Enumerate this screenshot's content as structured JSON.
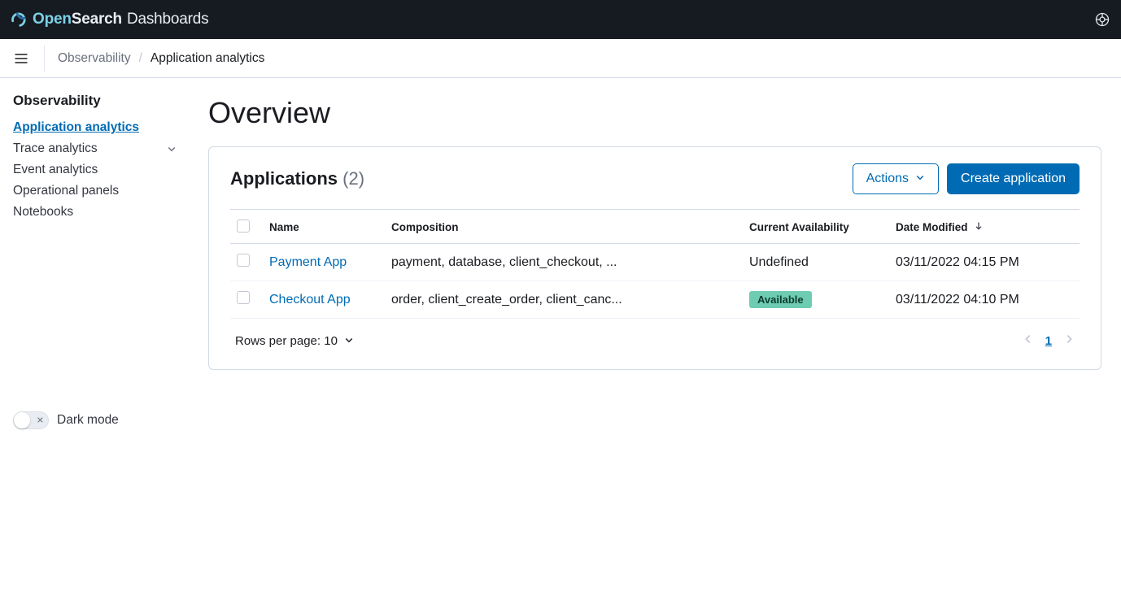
{
  "brand": {
    "open": "Open",
    "search": "Search",
    "dash": "Dashboards"
  },
  "breadcrumb": {
    "root": "Observability",
    "current": "Application analytics"
  },
  "sidebar": {
    "title": "Observability",
    "items": [
      {
        "label": "Application analytics",
        "active": true
      },
      {
        "label": "Trace analytics",
        "expandable": true
      },
      {
        "label": "Event analytics"
      },
      {
        "label": "Operational panels"
      },
      {
        "label": "Notebooks"
      }
    ],
    "dark_mode_label": "Dark mode"
  },
  "page": {
    "title": "Overview"
  },
  "panel": {
    "title": "Applications",
    "count_display": "(2)",
    "actions_label": "Actions",
    "create_label": "Create application"
  },
  "table": {
    "columns": {
      "name": "Name",
      "composition": "Composition",
      "availability": "Current Availability",
      "date_modified": "Date Modified"
    },
    "rows": [
      {
        "name": "Payment App",
        "composition": "payment, database, client_checkout, ...",
        "availability_text": "Undefined",
        "availability_badge": false,
        "date": "03/11/2022 04:15 PM"
      },
      {
        "name": "Checkout App",
        "composition": "order, client_create_order, client_canc...",
        "availability_text": "Available",
        "availability_badge": true,
        "date": "03/11/2022 04:10 PM"
      }
    ],
    "rows_per_page_label": "Rows per page: 10",
    "page_number": "1"
  }
}
